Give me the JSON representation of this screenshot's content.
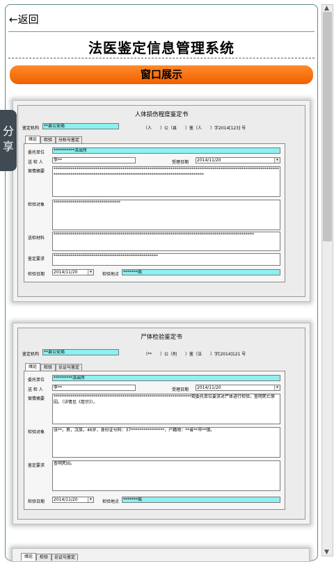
{
  "nav": {
    "back_arrow": "←",
    "back_label": "返回"
  },
  "header": {
    "title": "法医鉴定信息管理系统"
  },
  "section_bar": {
    "label": "窗口展示"
  },
  "share": {
    "label_1": "分",
    "label_2": "享"
  },
  "card1": {
    "title": "人体损伤程度鉴定书",
    "agency_label": "鉴定机构",
    "agency_value": "**县公安局",
    "ref_text": "（人　　）公（县　　）鉴（人　　）字2014[123] 号",
    "tabs": [
      "绪论",
      "检验",
      "分析与鉴定"
    ],
    "client_label": "委托单位",
    "client_value": "**********派出所",
    "sender_label": "送 检 人",
    "sender_value": "李**",
    "accept_date_label": "受理日期",
    "accept_date_value": "2014/11/20",
    "summary_label": "案情摘要",
    "summary_value": "************************************************************************************************************************************************************************************",
    "object_label": "检验对象",
    "object_value": "********************************",
    "material_label": "送检材料",
    "material_value": "************************************************************************************************",
    "request_label": "鉴定要求",
    "request_value": "**************************************************",
    "exam_date_label": "检验日期",
    "exam_date_value": "2014/11/20",
    "exam_place_label": "检验地点",
    "exam_place_value": "*******局"
  },
  "card2": {
    "title": "尸体检验鉴定书",
    "agency_label": "鉴定机构",
    "agency_value": "**县公安局",
    "ref_text": "（**　　）公（刑　　）鉴（法　　）字[2014]121 号",
    "tabs": [
      "绪论",
      "检验",
      "论证与鉴定"
    ],
    "client_label": "委托单位",
    "client_value": "*********派出所",
    "sender_label": "送 检 人",
    "sender_value": "李**",
    "accept_date_label": "受理日期",
    "accept_date_value": "2014/11/20",
    "summary_label": "案情摘要",
    "summary_value": "******************************************************************观委托单位要求对尸体进行检验，查明死亡原因。（详情见《卷宗》）。",
    "object_label": "检验对象",
    "object_value": "张**，男，汉族，46岁，身份证号码：37****************，户籍地：**省**市**镇。",
    "request_label": "鉴定要求",
    "request_value": "查明死因。",
    "exam_date_label": "检验日期",
    "exam_date_value": "2014/11/20",
    "exam_place_label": "检验地点",
    "exam_place_value": "*******局"
  },
  "strip_tabs": [
    "绪论",
    "检验",
    "论证与鉴定"
  ],
  "scrollbar": {
    "up": "▲",
    "down": "▼"
  }
}
